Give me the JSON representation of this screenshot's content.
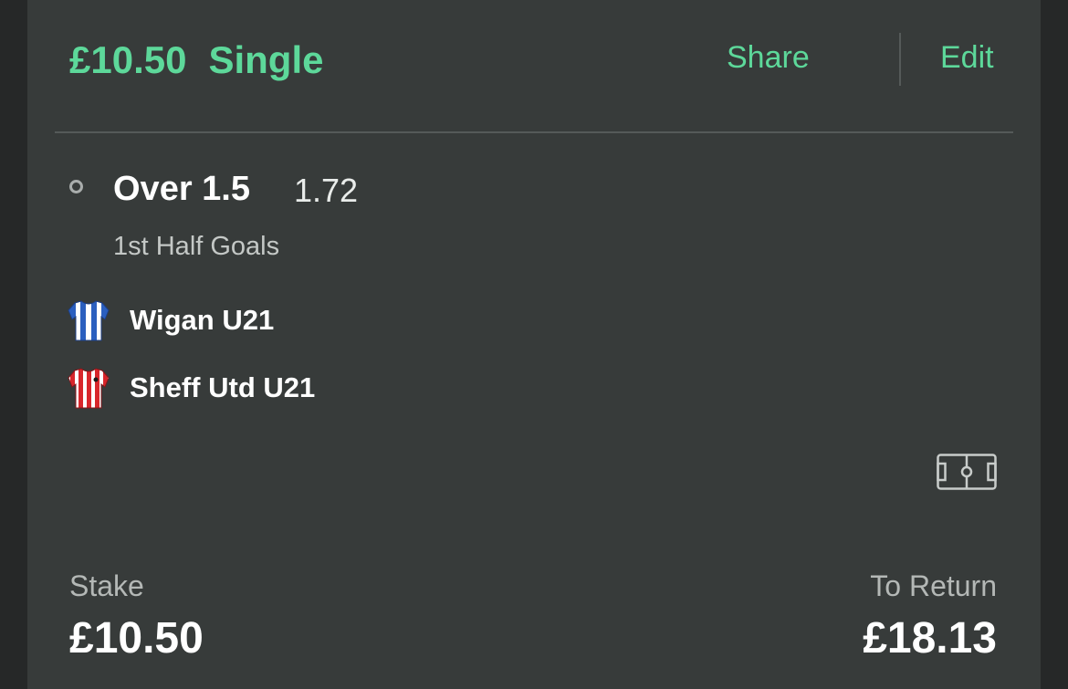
{
  "bet": {
    "stake_amount": "£10.50",
    "bet_type": "Single"
  },
  "header": {
    "share_label": "Share",
    "edit_label": "Edit"
  },
  "selection": {
    "name": "Over 1.5",
    "odds": "1.72",
    "market": "1st Half Goals"
  },
  "teams": [
    {
      "name": "Wigan U21",
      "kit_icon": "blue-white-striped-shirt-icon",
      "colors": [
        "#2b5fbf",
        "#ffffff"
      ]
    },
    {
      "name": "Sheff Utd U21",
      "kit_icon": "red-white-striped-shirt-icon",
      "colors": [
        "#d8262b",
        "#ffffff"
      ]
    }
  ],
  "footer": {
    "stake_label": "Stake",
    "stake_value": "£10.50",
    "return_label": "To Return",
    "return_value": "£18.13"
  },
  "icons": {
    "status": "open-circle-icon",
    "pitch": "football-pitch-icon"
  },
  "colors": {
    "accent": "#5dd89a",
    "card_bg": "#373b3a",
    "page_bg": "#262828"
  }
}
